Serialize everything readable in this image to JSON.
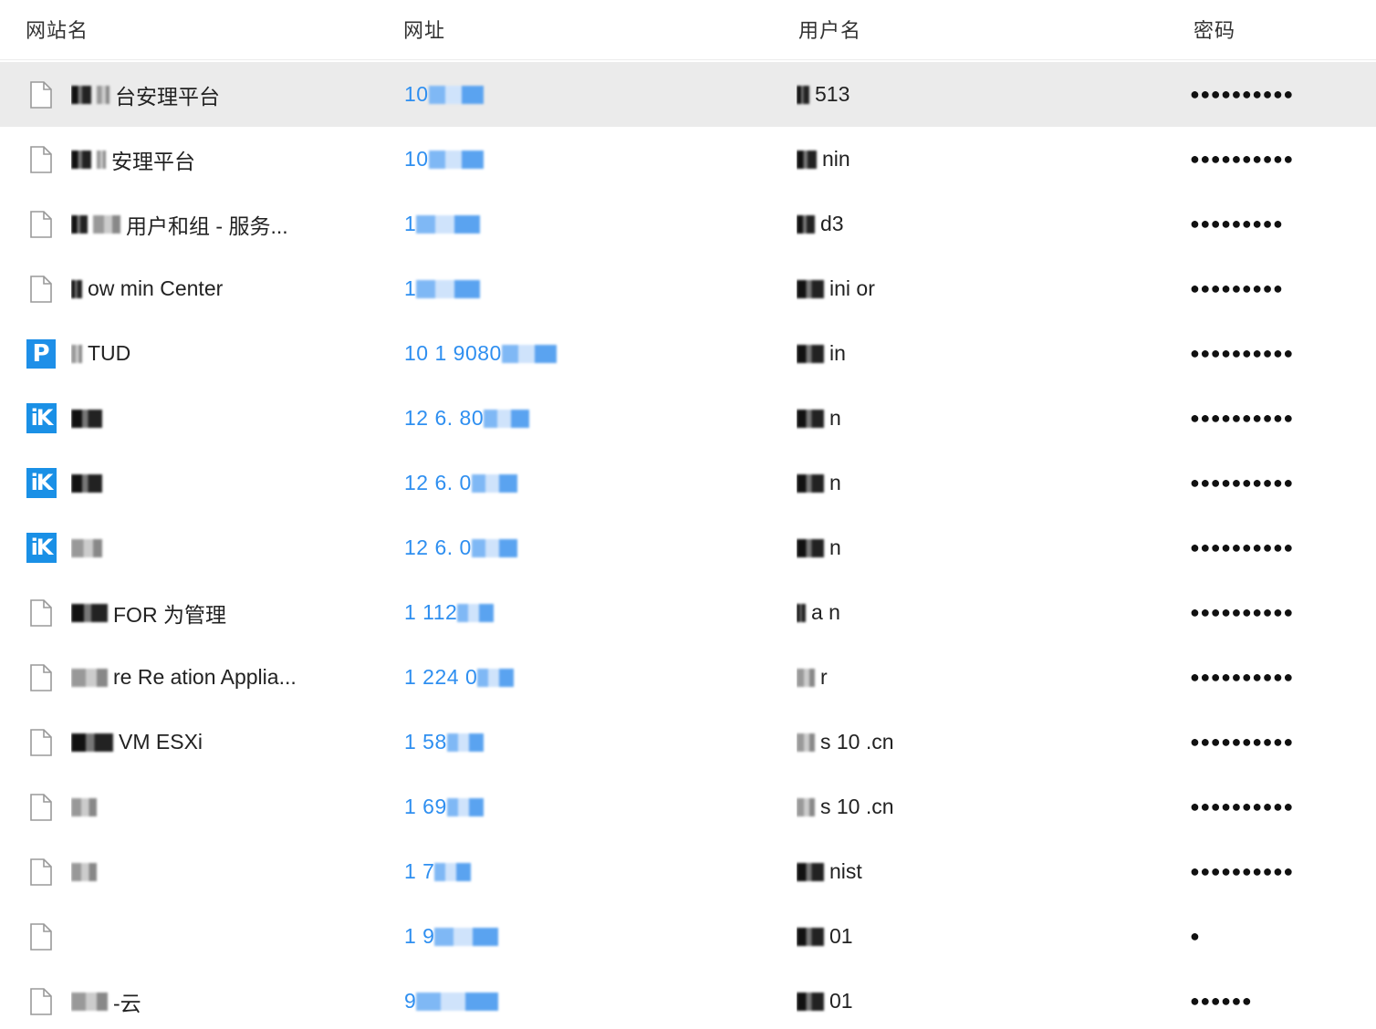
{
  "header": {
    "site": "网站名",
    "url": "网址",
    "user": "用户名",
    "password": "密码"
  },
  "rows": [
    {
      "icon": "file-icon",
      "name": "台安理平台",
      "url": "10",
      "user": "513",
      "password": "●●●●●●●●●●"
    },
    {
      "icon": "file-icon",
      "name": "安理平台",
      "url": "10",
      "user": "nin",
      "password": "●●●●●●●●●●"
    },
    {
      "icon": "file-icon",
      "name": "用户和组 - 服务...",
      "url": "1",
      "user": "d3",
      "password": "●●●●●●●●●"
    },
    {
      "icon": "file-icon",
      "name": "ow min Center",
      "url": "1",
      "user": "ini or",
      "password": "●●●●●●●●●"
    },
    {
      "icon": "p-app-icon",
      "name": "TUD",
      "url": "10 1 9080",
      "user": "in",
      "password": "●●●●●●●●●●"
    },
    {
      "icon": "ik-app-icon",
      "name": "",
      "url": "12 6. 80",
      "user": "n",
      "password": "●●●●●●●●●●"
    },
    {
      "icon": "ik-app-icon",
      "name": "",
      "url": "12 6. 0",
      "user": "n",
      "password": "●●●●●●●●●●"
    },
    {
      "icon": "ik-app-icon",
      "name": "",
      "url": "12 6. 0",
      "user": "n",
      "password": "●●●●●●●●●●"
    },
    {
      "icon": "file-icon",
      "name": "FOR 为管理",
      "url": "1 112",
      "user": "a n",
      "password": "●●●●●●●●●●"
    },
    {
      "icon": "file-icon",
      "name": "re Re ation Applia...",
      "url": "1 224 0",
      "user": "r",
      "password": "●●●●●●●●●●"
    },
    {
      "icon": "file-icon",
      "name": "VM ESXi",
      "url": "1 58",
      "user": "s 10 .cn",
      "password": "●●●●●●●●●●"
    },
    {
      "icon": "file-icon",
      "name": "",
      "url": "1 69",
      "user": "s 10 .cn",
      "password": "●●●●●●●●●●"
    },
    {
      "icon": "file-icon",
      "name": "",
      "url": "1 7",
      "user": "nist",
      "password": "●●●●●●●●●●"
    },
    {
      "icon": "file-icon",
      "name": "",
      "url": "1 9",
      "user": "01",
      "password": "●"
    },
    {
      "icon": "file-icon",
      "name": "-云",
      "url": "9",
      "user": "01",
      "password": "●●●●●●"
    }
  ]
}
